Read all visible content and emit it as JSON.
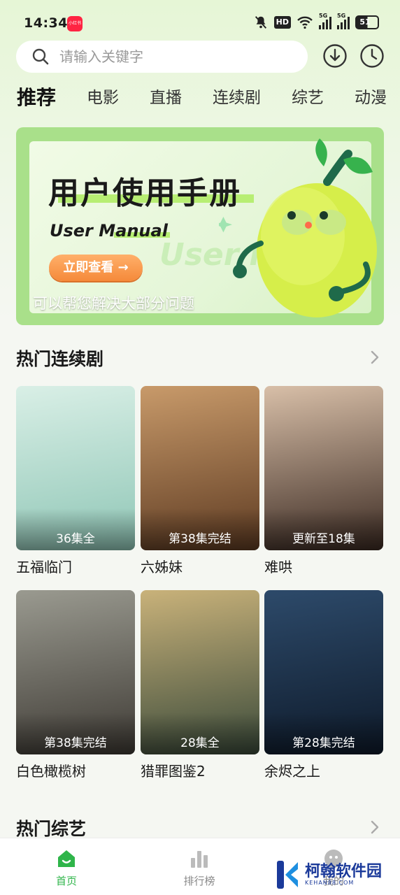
{
  "status_bar": {
    "time": "14:34",
    "app_badge": "小红书",
    "network_1": "5G",
    "network_2": "5G",
    "hd": "HD",
    "battery": "51"
  },
  "search": {
    "placeholder": "请输入关键字"
  },
  "tabs": [
    "推荐",
    "电影",
    "直播",
    "连续剧",
    "综艺",
    "动漫"
  ],
  "banner": {
    "title": "用户使用手册",
    "subtitle": "User Manual",
    "cta": "立即查看 →",
    "watermark_text": "User Manual",
    "caption": "可以帮您解决大部分问题"
  },
  "sections": {
    "hot_series": {
      "title": "热门连续剧",
      "items": [
        {
          "name": "五福临门",
          "episodes": "36集全",
          "colors": [
            "#d9efe6",
            "#8fc6b6"
          ]
        },
        {
          "name": "六姊妹",
          "episodes": "第38集完结",
          "colors": [
            "#c89a6a",
            "#5e3b22"
          ]
        },
        {
          "name": "难哄",
          "episodes": "更新至18集",
          "colors": [
            "#d8bfa8",
            "#3b2a22"
          ]
        },
        {
          "name": "白色橄榄树",
          "episodes": "第38集完结",
          "colors": [
            "#9a9a90",
            "#3e3a34"
          ]
        },
        {
          "name": "猎罪图鉴2",
          "episodes": "28集全",
          "colors": [
            "#c9b27a",
            "#3a4a3a"
          ]
        },
        {
          "name": "余烬之上",
          "episodes": "第28集完结",
          "colors": [
            "#2d4a6a",
            "#0e1a2a"
          ]
        }
      ]
    },
    "hot_variety": {
      "title": "热门综艺"
    }
  },
  "bottom_nav": [
    {
      "label": "首页",
      "active": true
    },
    {
      "label": "排行榜",
      "active": false
    },
    {
      "label": "我的",
      "active": false
    }
  ],
  "watermark": {
    "name": "柯翰软件园",
    "domain": "KEHAN88.COM"
  },
  "colors": {
    "accent": "#2fb54a",
    "banner_green": "#a9e08a",
    "cta_orange": "#f58a3a"
  }
}
